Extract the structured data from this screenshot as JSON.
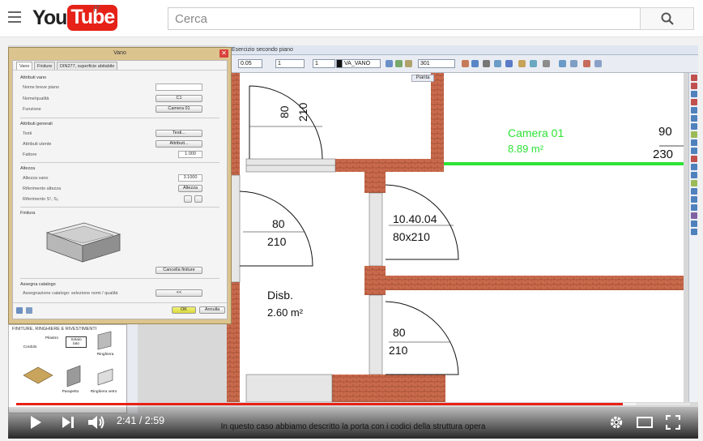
{
  "header": {
    "logo_you": "You",
    "logo_tube": "Tube",
    "region": "IT",
    "search_placeholder": "Cerca"
  },
  "cad": {
    "window_title": "Esercizio secondo piano",
    "toolbar": {
      "scale": "0.05",
      "pen": "1",
      "line": "1",
      "layer": "VA_VANO",
      "style": "301"
    },
    "view_label": "Pianta"
  },
  "drawing": {
    "room1_name": "Camera 01",
    "room1_area": "8.89 m²",
    "room1_h1": "90",
    "room1_h2": "230",
    "door1_w": "80",
    "door1_h": "210",
    "door2_w": "80",
    "door2_h": "210",
    "door3_code": "10.40.04",
    "door3_size": "80x210",
    "room2_name": "Disb.",
    "room2_area": "2.60 m²",
    "door4_w": "80",
    "door4_h": "210"
  },
  "dialog": {
    "title": "Vano",
    "tabs": [
      "Vano",
      "Finiture",
      "DIN277, superficie abitabile"
    ],
    "sec_attributes": "Attributi vano",
    "label_short_name": "Nome breve piano",
    "label_name": "Nome/qualità",
    "value_name": "C1",
    "label_function": "Funzione",
    "value_function": "Camera 01",
    "sec_general": "Attributi generali",
    "label_texts": "Testi",
    "btn_texts": "Testi...",
    "label_user_attr": "Attributi utente",
    "btn_attr": "Attributi...",
    "label_factor": "Fattore",
    "value_factor": "1.000",
    "sec_height": "Altezza",
    "label_room_height": "Altezza vano",
    "value_room_height": "3.1000",
    "label_height_ref": "Riferimento altezza",
    "btn_height": "Altezza",
    "label_ref_s": "Riferimento S¹, S₂",
    "sec_finish": "Finitura",
    "btn_delete_finish": "Cancella finiture",
    "sec_catalog": "Assegna catalogo",
    "label_catalog_assign": "Assegnazione catalogo: selezione nomi / qualità",
    "btn_catalog": "<<",
    "btn_ok": "OK",
    "btn_cancel": "Annulla"
  },
  "catalog": {
    "title": "FINITURE, RINGHIERE E RIVESTIMENTI",
    "items": [
      "Pilastro",
      "Solaio lato",
      "Cordolo",
      "Ringhiera",
      "Parapetto",
      "Ringhiera vetro"
    ]
  },
  "player": {
    "current_time": "2:41",
    "duration": "2:59",
    "time_separator": " / ",
    "progress": 0.9,
    "loaded": 0.92,
    "caption": "In questo caso abbiamo descritto la porta con i codici della struttura opera"
  },
  "colors": {
    "brand_red": "#e62117",
    "dialog_frame": "#dcc48f",
    "wall": "#c96a4c",
    "room_label": "#2ee336"
  }
}
